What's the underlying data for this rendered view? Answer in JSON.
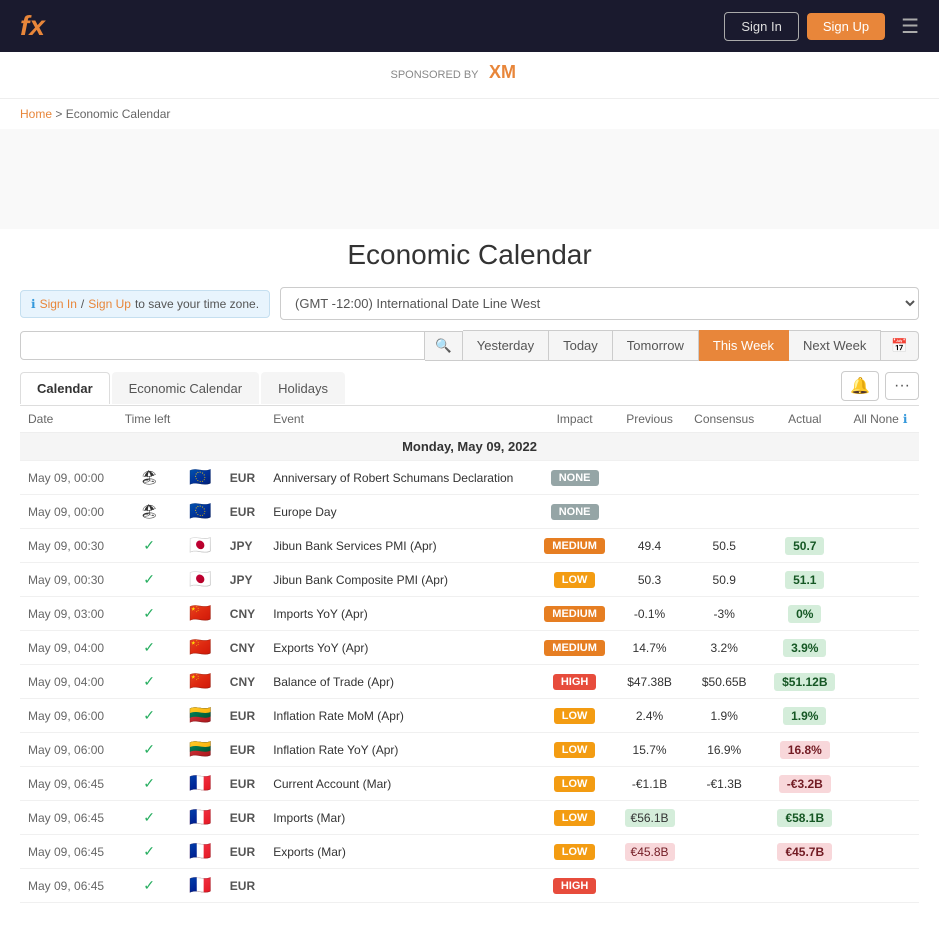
{
  "header": {
    "logo": "fx",
    "signin_label": "Sign In",
    "signup_label": "Sign Up"
  },
  "sponsor": {
    "label": "SPONSORED BY",
    "logo_text": "XM"
  },
  "breadcrumb": {
    "home": "Home",
    "separator": ">",
    "current": "Economic Calendar"
  },
  "page": {
    "title": "Economic Calendar"
  },
  "timezone": {
    "info_prefix": "",
    "signin_label": "Sign In",
    "signup_label": "Sign Up",
    "info_suffix": "to save your time zone.",
    "selected": "(GMT -12:00) International Date Line West"
  },
  "date_nav": {
    "search_placeholder": "",
    "buttons": [
      "Yesterday",
      "Today",
      "Tomorrow",
      "This Week",
      "Next Week"
    ],
    "active_index": 3
  },
  "tabs": {
    "items": [
      "Calendar",
      "Economic Calendar",
      "Holidays"
    ],
    "active_index": 0
  },
  "table": {
    "headers": {
      "date": "Date",
      "time_left": "Time left",
      "event": "Event",
      "impact": "Impact",
      "previous": "Previous",
      "consensus": "Consensus",
      "actual": "Actual",
      "all_none": "All None"
    },
    "date_section": "Monday, May 09, 2022",
    "rows": [
      {
        "date": "May 09, 00:00",
        "time_left_icon": "holiday",
        "flag": "eu",
        "currency": "EUR",
        "event": "Anniversary of Robert Schumans Declaration",
        "impact": "NONE",
        "previous": "",
        "consensus": "",
        "actual": "",
        "actual_type": ""
      },
      {
        "date": "May 09, 00:00",
        "time_left_icon": "holiday",
        "flag": "eu",
        "currency": "EUR",
        "event": "Europe Day",
        "impact": "NONE",
        "previous": "",
        "consensus": "",
        "actual": "",
        "actual_type": ""
      },
      {
        "date": "May 09, 00:30",
        "time_left_icon": "check",
        "flag": "jp",
        "currency": "JPY",
        "event": "Jibun Bank Services PMI (Apr)",
        "impact": "MEDIUM",
        "previous": "49.4",
        "consensus": "50.5",
        "actual": "50.7",
        "actual_type": "green"
      },
      {
        "date": "May 09, 00:30",
        "time_left_icon": "check",
        "flag": "jp",
        "currency": "JPY",
        "event": "Jibun Bank Composite PMI (Apr)",
        "impact": "LOW",
        "previous": "50.3",
        "consensus": "50.9",
        "actual": "51.1",
        "actual_type": "green"
      },
      {
        "date": "May 09, 03:00",
        "time_left_icon": "check",
        "flag": "cn",
        "currency": "CNY",
        "event": "Imports YoY (Apr)",
        "impact": "MEDIUM",
        "previous": "-0.1%",
        "consensus": "-3%",
        "actual": "0%",
        "actual_type": "green"
      },
      {
        "date": "May 09, 04:00",
        "time_left_icon": "check",
        "flag": "cn",
        "currency": "CNY",
        "event": "Exports YoY (Apr)",
        "impact": "MEDIUM",
        "previous": "14.7%",
        "consensus": "3.2%",
        "actual": "3.9%",
        "actual_type": "green"
      },
      {
        "date": "May 09, 04:00",
        "time_left_icon": "check",
        "flag": "cn",
        "currency": "CNY",
        "event": "Balance of Trade (Apr)",
        "impact": "HIGH",
        "previous": "$47.38B",
        "consensus": "$50.65B",
        "actual": "$51.12B",
        "actual_type": "green"
      },
      {
        "date": "May 09, 06:00",
        "time_left_icon": "check",
        "flag": "lt",
        "currency": "EUR",
        "event": "Inflation Rate MoM (Apr)",
        "impact": "LOW",
        "previous": "2.4%",
        "consensus": "1.9%",
        "actual": "1.9%",
        "actual_type": "green"
      },
      {
        "date": "May 09, 06:00",
        "time_left_icon": "check",
        "flag": "lt",
        "currency": "EUR",
        "event": "Inflation Rate YoY (Apr)",
        "impact": "LOW",
        "previous": "15.7%",
        "consensus": "16.9%",
        "actual": "16.8%",
        "actual_type": "red"
      },
      {
        "date": "May 09, 06:45",
        "time_left_icon": "check",
        "flag": "fr",
        "currency": "EUR",
        "event": "Current Account (Mar)",
        "impact": "LOW",
        "previous": "-€1.1B",
        "consensus": "-€1.3B",
        "actual": "-€3.2B",
        "actual_type": "red"
      },
      {
        "date": "May 09, 06:45",
        "time_left_icon": "check",
        "flag": "fr",
        "currency": "EUR",
        "event": "Imports (Mar)",
        "impact": "LOW",
        "previous": "€56.1B",
        "consensus": "",
        "actual": "€58.1B",
        "actual_type": "green",
        "prev_highlight": true
      },
      {
        "date": "May 09, 06:45",
        "time_left_icon": "check",
        "flag": "fr",
        "currency": "EUR",
        "event": "Exports (Mar)",
        "impact": "LOW",
        "previous": "€45.8B",
        "consensus": "",
        "actual": "€45.7B",
        "actual_type": "red",
        "prev_highlight": true
      },
      {
        "date": "May 09, 06:45",
        "time_left_icon": "check",
        "flag": "fr",
        "currency": "EUR",
        "event": "",
        "impact": "HIGH",
        "previous": "",
        "consensus": "",
        "actual": "",
        "actual_type": "red",
        "last_row": true
      }
    ]
  }
}
